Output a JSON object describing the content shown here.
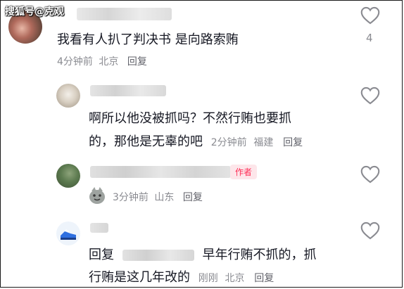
{
  "watermark": "搜狐号@克观",
  "comments": [
    {
      "text": "我看有人扒了判决书 是向路索贿",
      "time": "4分钟前",
      "location": "北京",
      "reply_label": "回复",
      "like_count": "4"
    },
    {
      "text_line1": "啊所以他没被抓吗？不然行贿也要抓",
      "text_line2": "的，那他是无辜的吧",
      "time": "2分钟前",
      "location": "福建",
      "reply_label": "回复"
    },
    {
      "author_badge": "作者",
      "time": "3分钟前",
      "location": "山东",
      "reply_label": "回复"
    },
    {
      "reply_prefix": "回复",
      "text_line1_after": "早年行贿不抓的，抓",
      "text_line2": "行贿是这几年改的",
      "time": "刚刚",
      "location": "北京",
      "reply_label": "回复"
    }
  ],
  "colors": {
    "author_badge_bg": "#fde6ea",
    "author_badge_text": "#fe2c55",
    "meta": "#8a8b91"
  }
}
